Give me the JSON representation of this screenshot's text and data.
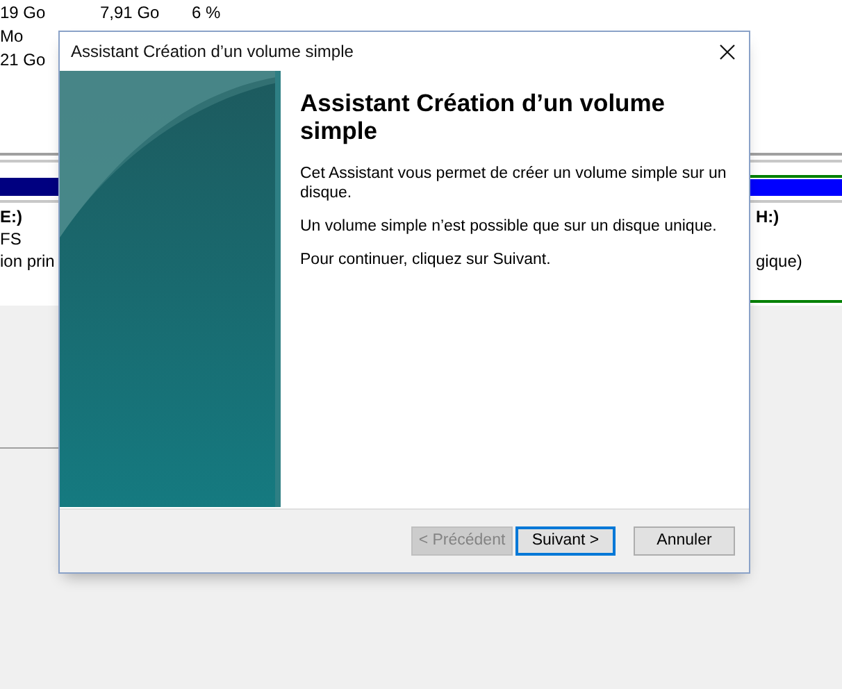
{
  "background": {
    "volume_rows": [
      [
        "19 Go",
        "7,91 Go",
        "6 %"
      ],
      [
        "Mo"
      ],
      [
        "21 Go"
      ]
    ],
    "left_partition": {
      "name": "E:)",
      "filesystem": "FS",
      "status": "ion prin"
    },
    "right_partition": {
      "name": "H:)",
      "status": "gique)"
    }
  },
  "dialog": {
    "title": "Assistant Création d’un volume simple",
    "heading": "Assistant Création d’un volume simple",
    "paragraphs": [
      "Cet Assistant vous permet de créer un volume simple sur un disque.",
      "Un volume simple n’est possible que sur un disque unique.",
      "Pour continuer, cliquez sur Suivant."
    ],
    "buttons": [
      {
        "label": "< Précédent",
        "disabled": true,
        "focused": false
      },
      {
        "label": "Suivant >",
        "disabled": false,
        "focused": true
      },
      {
        "label": "Annuler",
        "disabled": false,
        "focused": false
      }
    ]
  }
}
